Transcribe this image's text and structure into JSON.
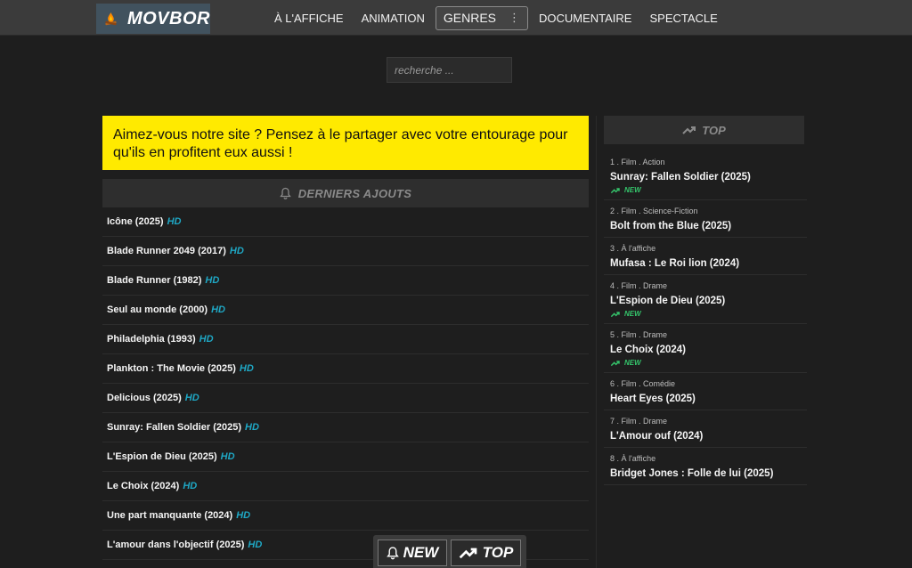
{
  "brand": {
    "name": "MOVBOR"
  },
  "nav": {
    "items": [
      "À L'AFFICHE",
      "ANIMATION"
    ],
    "genres": "GENRES",
    "items_after": [
      "DOCUMENTAIRE",
      "SPECTACLE"
    ]
  },
  "search": {
    "placeholder": "recherche ..."
  },
  "banner": {
    "text": "Aimez-vous notre site ? Pensez à le partager avec votre entourage pour qu'ils en profitent eux aussi !"
  },
  "latest": {
    "heading": "DERNIERS AJOUTS",
    "hd_label": "HD",
    "items": [
      "Icône (2025)",
      "Blade Runner 2049 (2017)",
      "Blade Runner (1982)",
      "Seul au monde (2000)",
      "Philadelphia (1993)",
      "Plankton : The Movie (2025)",
      "Delicious (2025)",
      "Sunray: Fallen Soldier (2025)",
      "L'Espion de Dieu (2025)",
      "Le Choix (2024)",
      "Une part manquante (2024)",
      "L'amour dans l'objectif (2025)"
    ]
  },
  "top": {
    "heading": "TOP",
    "new_label": "NEW",
    "items": [
      {
        "meta": "1 . Film . Action",
        "title": "Sunray: Fallen Soldier (2025)",
        "is_new": true
      },
      {
        "meta": "2 . Film . Science-Fiction",
        "title": "Bolt from the Blue (2025)",
        "is_new": false
      },
      {
        "meta": "3 . À l'affiche",
        "title": "Mufasa : Le Roi lion (2024)",
        "is_new": false
      },
      {
        "meta": "4 . Film . Drame",
        "title": "L'Espion de Dieu (2025)",
        "is_new": true
      },
      {
        "meta": "5 . Film . Drame",
        "title": "Le Choix (2024)",
        "is_new": true
      },
      {
        "meta": "6 . Film . Comédie",
        "title": "Heart Eyes (2025)",
        "is_new": false
      },
      {
        "meta": "7 . Film . Drame",
        "title": "L'Amour ouf (2024)",
        "is_new": false
      },
      {
        "meta": "8 . À l'affiche",
        "title": "Bridget Jones : Folle de lui (2025)",
        "is_new": false
      }
    ]
  },
  "floating": {
    "new_label": "NEW",
    "top_label": "TOP"
  },
  "colors": {
    "accent_yellow": "#ffea00",
    "hd_blue": "#1fa7c4",
    "new_green": "#35c46b",
    "nav_bg": "#3b3b3b",
    "page_bg": "#1e1e1e"
  }
}
